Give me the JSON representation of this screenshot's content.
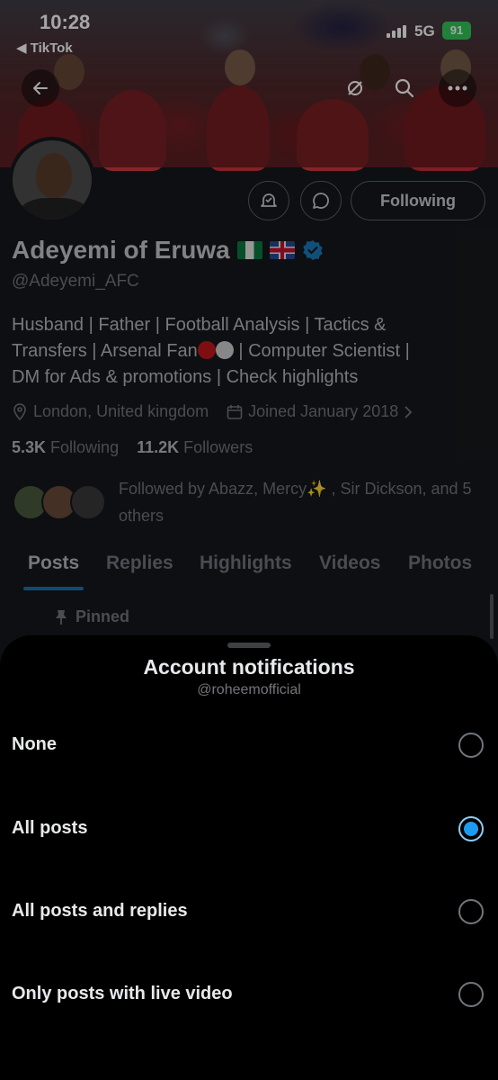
{
  "status_bar": {
    "time": "10:28",
    "back_app": "◀ TikTok",
    "network": "5G",
    "battery": "91"
  },
  "profile": {
    "name": "Adeyemi of Eruwa",
    "handle": "@Adeyemi_AFC",
    "bio_line1": "Husband | Father | Football Analysis | Tactics &",
    "bio_line2a": "Transfers | Arsenal Fan",
    "bio_line2b": " | Computer Scientist |",
    "bio_line3": "DM for Ads & promotions | Check highlights",
    "location": "London, United kingdom",
    "joined": "Joined January 2018",
    "following_count": "5.3K",
    "following_label": "Following",
    "followers_count": "11.2K",
    "followers_label": "Followers",
    "followed_by": "Followed by Abazz, Mercy✨ , Sir Dickson, and 5 others",
    "following_button": "Following",
    "verified_color": "#1d9bf0"
  },
  "tabs": [
    "Posts",
    "Replies",
    "Highlights",
    "Videos",
    "Photos"
  ],
  "active_tab": "Posts",
  "pinned_label": "Pinned",
  "sheet": {
    "title": "Account notifications",
    "subtitle": "@roheemofficial",
    "options": [
      {
        "label": "None",
        "selected": false
      },
      {
        "label": "All posts",
        "selected": true
      },
      {
        "label": "All posts and replies",
        "selected": false
      },
      {
        "label": "Only posts with live video",
        "selected": false
      }
    ],
    "accent_color": "#1d9bf0"
  }
}
